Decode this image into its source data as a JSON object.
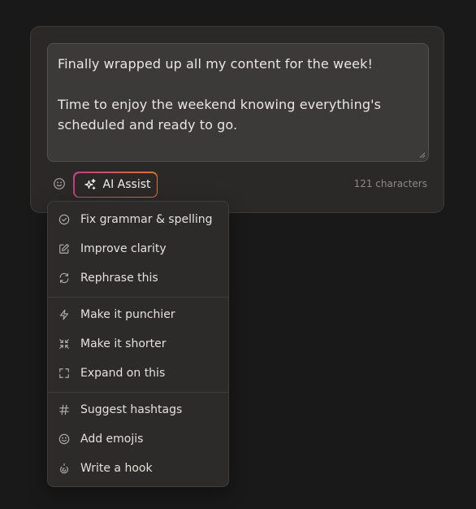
{
  "composer": {
    "text": "Finally wrapped up all my content for the week!\n\nTime to enjoy the weekend knowing everything's scheduled and ready to go.",
    "char_count": "121 characters",
    "ai_assist_label": "AI Assist"
  },
  "menu": {
    "groups": [
      [
        {
          "label": "Fix grammar & spelling",
          "icon": "check-circle-icon"
        },
        {
          "label": "Improve clarity",
          "icon": "edit-icon"
        },
        {
          "label": "Rephrase this",
          "icon": "refresh-icon"
        }
      ],
      [
        {
          "label": "Make it punchier",
          "icon": "lightning-icon"
        },
        {
          "label": "Make it shorter",
          "icon": "minimize-icon"
        },
        {
          "label": "Expand on this",
          "icon": "maximize-icon"
        }
      ],
      [
        {
          "label": "Suggest hashtags",
          "icon": "hash-icon"
        },
        {
          "label": "Add emojis",
          "icon": "smile-icon"
        },
        {
          "label": "Write a hook",
          "icon": "hook-icon"
        }
      ]
    ]
  },
  "colors": {
    "background": "#1a1919",
    "card": "#2a2928",
    "textarea": "#3b3a38",
    "menu": "#2c2b29",
    "gradient_start": "#c0417f",
    "gradient_end": "#d6743c"
  }
}
